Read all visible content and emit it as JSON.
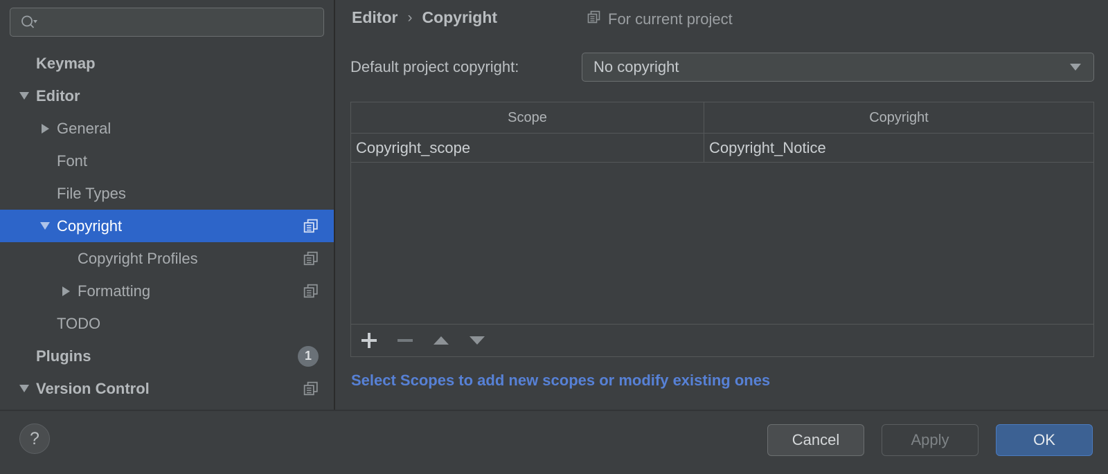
{
  "search": {
    "placeholder": "",
    "value": "",
    "icon": "search-icon"
  },
  "sidebar": {
    "items": [
      {
        "label": "Keymap",
        "indent": 0,
        "twisty": "none",
        "bold": true,
        "selected": false,
        "right": "none"
      },
      {
        "label": "Editor",
        "indent": 0,
        "twisty": "down",
        "bold": true,
        "selected": false,
        "right": "none"
      },
      {
        "label": "General",
        "indent": 1,
        "twisty": "right",
        "bold": false,
        "selected": false,
        "right": "none"
      },
      {
        "label": "Font",
        "indent": 1,
        "twisty": "none",
        "bold": false,
        "selected": false,
        "right": "none"
      },
      {
        "label": "File Types",
        "indent": 1,
        "twisty": "none",
        "bold": false,
        "selected": false,
        "right": "none"
      },
      {
        "label": "Copyright",
        "indent": 1,
        "twisty": "down",
        "bold": false,
        "selected": true,
        "right": "copy-icon"
      },
      {
        "label": "Copyright Profiles",
        "indent": 2,
        "twisty": "none",
        "bold": false,
        "selected": false,
        "right": "copy-icon"
      },
      {
        "label": "Formatting",
        "indent": 2,
        "twisty": "right",
        "bold": false,
        "selected": false,
        "right": "copy-icon"
      },
      {
        "label": "TODO",
        "indent": 1,
        "twisty": "none",
        "bold": false,
        "selected": false,
        "right": "none"
      },
      {
        "label": "Plugins",
        "indent": 0,
        "twisty": "none",
        "bold": true,
        "selected": false,
        "right": "badge",
        "badge": "1"
      },
      {
        "label": "Version Control",
        "indent": 0,
        "twisty": "down",
        "bold": true,
        "selected": false,
        "right": "copy-icon"
      }
    ]
  },
  "content": {
    "breadcrumb": {
      "parent": "Editor",
      "separator": "›",
      "current": "Copyright"
    },
    "for_current_project": "For current project",
    "default_copyright": {
      "label": "Default project copyright:",
      "value": "No copyright"
    },
    "table": {
      "columns": [
        "Scope",
        "Copyright"
      ],
      "rows": [
        {
          "scope": "Copyright_scope",
          "copyright": "Copyright_Notice"
        }
      ]
    },
    "toolbar": {
      "add": "add-button",
      "remove": "remove-button",
      "move_up": "move-up-button",
      "move_down": "move-down-button"
    },
    "scopes_link": "Select Scopes to add new scopes or modify existing ones"
  },
  "footer": {
    "help": "?",
    "cancel": "Cancel",
    "apply": "Apply",
    "ok": "OK"
  },
  "colors": {
    "background": "#3c3f41",
    "selection": "#2d65c9",
    "link": "#5781d6",
    "primary_button": "#3c6193",
    "text": "#b9bdc0"
  }
}
